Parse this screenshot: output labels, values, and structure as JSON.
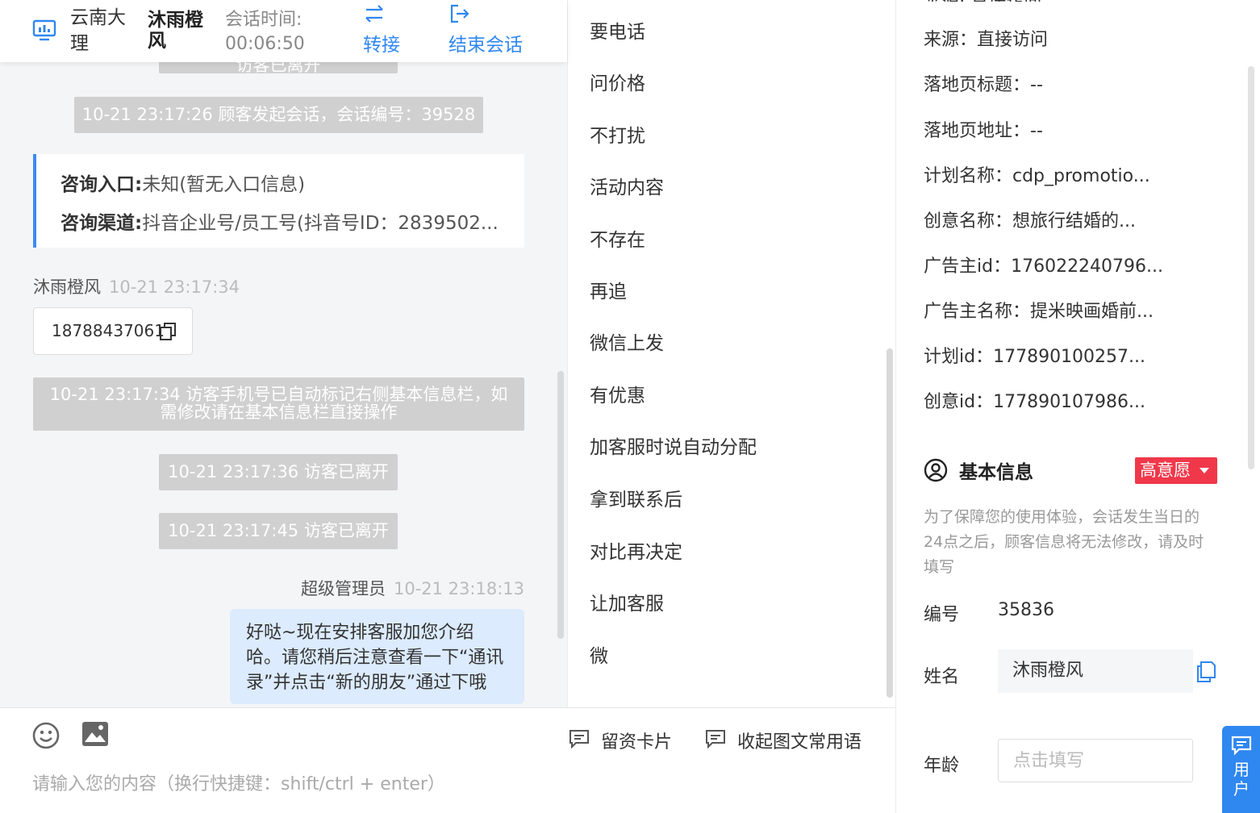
{
  "header": {
    "location": "云南大理",
    "visitor_name": "沐雨橙风",
    "session_time_label": "会话时间:",
    "session_time": "00:06:50",
    "transfer_label": "转接",
    "end_label": "结束会话"
  },
  "chat": {
    "partial_system": "访客已离开",
    "system_start": "10-21 23:17:26 顾客发起会话，会话编号：39528",
    "consult": {
      "entry_label": "咨询入口:",
      "entry_value": "未知(暂无入口信息)",
      "channel_label": "咨询渠道:",
      "channel_value": "抖音企业号/员工号(抖音号ID：2839502..."
    },
    "visitor": {
      "name": "沐雨橙风",
      "time": "10-21 23:17:34",
      "phone": "18788437061"
    },
    "system_phone_note": "10-21 23:17:34 访客手机号已自动标记右侧基本信息栏，如需修改请在基本信息栏直接操作",
    "system_left_1": "10-21 23:17:36 访客已离开",
    "system_left_2": "10-21 23:17:45 访客已离开",
    "agent": {
      "name": "超级管理员",
      "time": "10-21 23:18:13",
      "message": "好哒~现在安排客服加您介绍哈。请您稍后注意查看一下“通讯录”并点击“新的朋友”通过下哦"
    }
  },
  "composer": {
    "card_label": "留资卡片",
    "collapse_label": "收起图文常用语",
    "placeholder": "请输入您的内容（换行快捷键：shift/ctrl + enter）"
  },
  "phrases": [
    "要电话",
    "问价格",
    "不打扰",
    "活动内容",
    "不存在",
    "再追",
    "微信上发",
    "有优惠",
    "加客服时说自动分配",
    "拿到联系后",
    "对比再决定",
    "让加客服",
    "微"
  ],
  "info": {
    "partial_top": "来源:  直接访问",
    "source": "来源：直接访问",
    "landing_title": "落地页标题：--",
    "landing_url": "落地页地址：--",
    "plan_name": "计划名称：cdp_promotio...",
    "creative_name": "创意名称：想旅行结婚的...",
    "advertiser_id": "广告主id：176022240796...",
    "advertiser_name": "广告主名称：提米映画婚前...",
    "plan_id": "计划id：177890100257...",
    "creative_id": "创意id：177890107986...",
    "basic_title": "基本信息",
    "intent_tag": "高意愿",
    "notice": "为了保障您的使用体验，会话发生当日的24点之后，顾客信息将无法修改，请及时填写",
    "id_label": "编号",
    "id_value": "35836",
    "name_label": "姓名",
    "name_value": "沐雨橙风",
    "age_label": "年龄",
    "age_placeholder": "点击填写",
    "user_tab": "用户"
  },
  "colors": {
    "accent": "#2f87f0",
    "tag_red": "#f0384a",
    "agent_bubble": "#dcebfd",
    "system_bg": "#d0d0d0"
  }
}
